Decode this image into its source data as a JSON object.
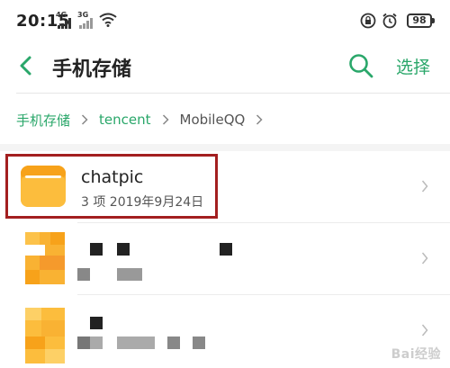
{
  "status_bar": {
    "time": "20:15",
    "network1": "4G",
    "network2": "3G",
    "battery": "98"
  },
  "app_bar": {
    "title": "手机存储",
    "select_label": "选择"
  },
  "breadcrumb": {
    "items": [
      "手机存储",
      "tencent",
      "MobileQQ"
    ]
  },
  "list": {
    "items": [
      {
        "name": "chatpic",
        "meta": "3 项  2019年9月24日",
        "redacted": false
      },
      {
        "name": "",
        "meta": "",
        "redacted": true
      },
      {
        "name": "",
        "meta": "",
        "redacted": true
      }
    ]
  },
  "watermark": "Bai经验",
  "colors": {
    "accent": "#2aa76a",
    "folder": "#f9b233",
    "highlight": "#a31f20"
  },
  "icons": [
    "back-icon",
    "search-icon",
    "chevron-right-icon",
    "folder-icon",
    "wifi-icon",
    "lock-icon",
    "alarm-icon",
    "battery-icon"
  ]
}
